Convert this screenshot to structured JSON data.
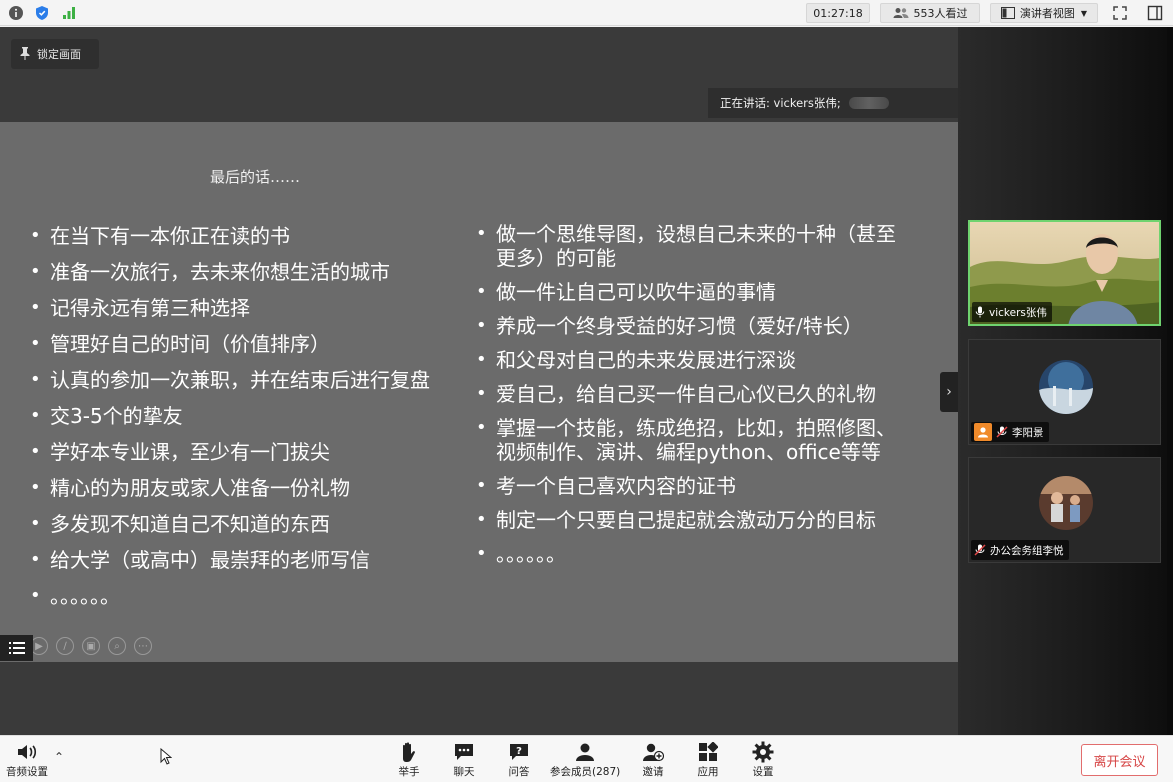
{
  "topbar": {
    "timer": "01:27:18",
    "viewers": "553人看过",
    "view_mode": "演讲者视图"
  },
  "stage": {
    "lock_label": "锁定画面",
    "speaking_label": "正在讲话: vickers张伟;"
  },
  "slide": {
    "title": "最后的话……",
    "left_items": [
      "在当下有一本你正在读的书",
      "准备一次旅行，去未来你想生活的城市",
      "记得永远有第三种选择",
      "管理好自己的时间（价值排序）",
      "认真的参加一次兼职，并在结束后进行复盘",
      "交3-5个的挚友",
      "学好本专业课，至少有一门拔尖",
      "精心的为朋友或家人准备一份礼物",
      "多发现不知道自己不知道的东西",
      "给大学（或高中）最崇拜的老师写信",
      "。。。。。。"
    ],
    "right_items": [
      "做一个思维导图，设想自己未来的十种（甚至更多）的可能",
      "做一件让自己可以吹牛逼的事情",
      "养成一个终身受益的好习惯（爱好/特长）",
      "和父母对自己的未来发展进行深谈",
      "爱自己，给自己买一件自己心仪已久的礼物",
      "掌握一个技能，练成绝招，比如，拍照修图、视频制作、演讲、编程python、office等等",
      "考一个自己喜欢内容的证书",
      "制定一个只要自己提起就会激动万分的目标",
      "。。。。。。"
    ]
  },
  "participants": [
    {
      "name": "vickers张伟",
      "active": true
    },
    {
      "name": "李阳景",
      "active": false
    },
    {
      "name": "办公会务组李悦",
      "active": false
    }
  ],
  "toolbar": {
    "audio": "音频设置",
    "raise_hand": "举手",
    "chat": "聊天",
    "qa": "问答",
    "members": "参会成员(287)",
    "invite": "邀请",
    "apps": "应用",
    "settings": "设置",
    "leave": "离开会议"
  },
  "colors": {
    "slide_bg": "#6b6b6b",
    "stage_bg": "#3a3a3a",
    "active_speaker_border": "#6fd36f",
    "leave_red": "#d64545"
  }
}
